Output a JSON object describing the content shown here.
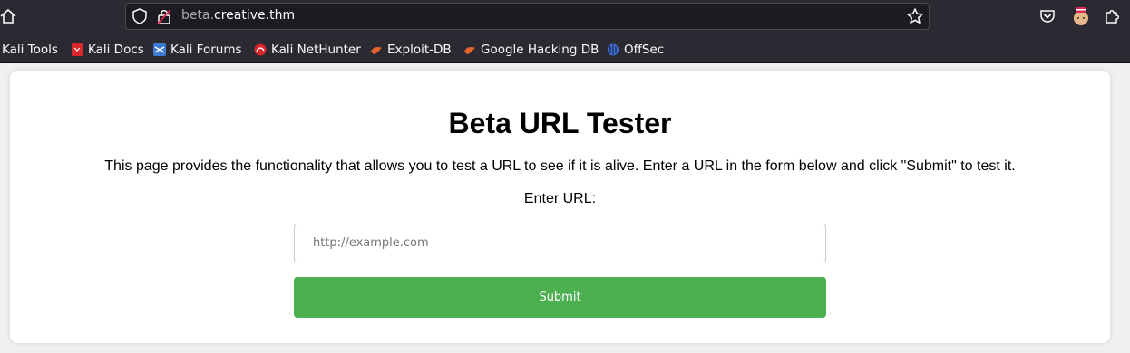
{
  "browser": {
    "url_subdomain": "beta.",
    "url_domain": "creative.thm",
    "bookmarks": [
      {
        "label": "Kali Tools",
        "icon": "kali-tools-icon"
      },
      {
        "label": "Kali Docs",
        "icon": "kali-docs-icon"
      },
      {
        "label": "Kali Forums",
        "icon": "kali-forums-icon"
      },
      {
        "label": "Kali NetHunter",
        "icon": "kali-nethunter-icon"
      },
      {
        "label": "Exploit-DB",
        "icon": "exploit-db-icon"
      },
      {
        "label": "Google Hacking DB",
        "icon": "google-hacking-db-icon"
      },
      {
        "label": "OffSec",
        "icon": "offsec-icon"
      }
    ],
    "colors": {
      "toolbar": "#2b2a33",
      "urlbar": "#1c1b22"
    }
  },
  "page": {
    "title": "Beta URL Tester",
    "description": "This page provides the functionality that allows you to test a URL to see if it is alive. Enter a URL in the form below and click \"Submit\" to test it.",
    "form": {
      "label": "Enter URL:",
      "url_placeholder": "http://example.com",
      "url_value": "",
      "submit_label": "Submit"
    },
    "colors": {
      "submit_button": "#4caf50",
      "card": "#ffffff",
      "background": "#f0f0f0"
    }
  }
}
